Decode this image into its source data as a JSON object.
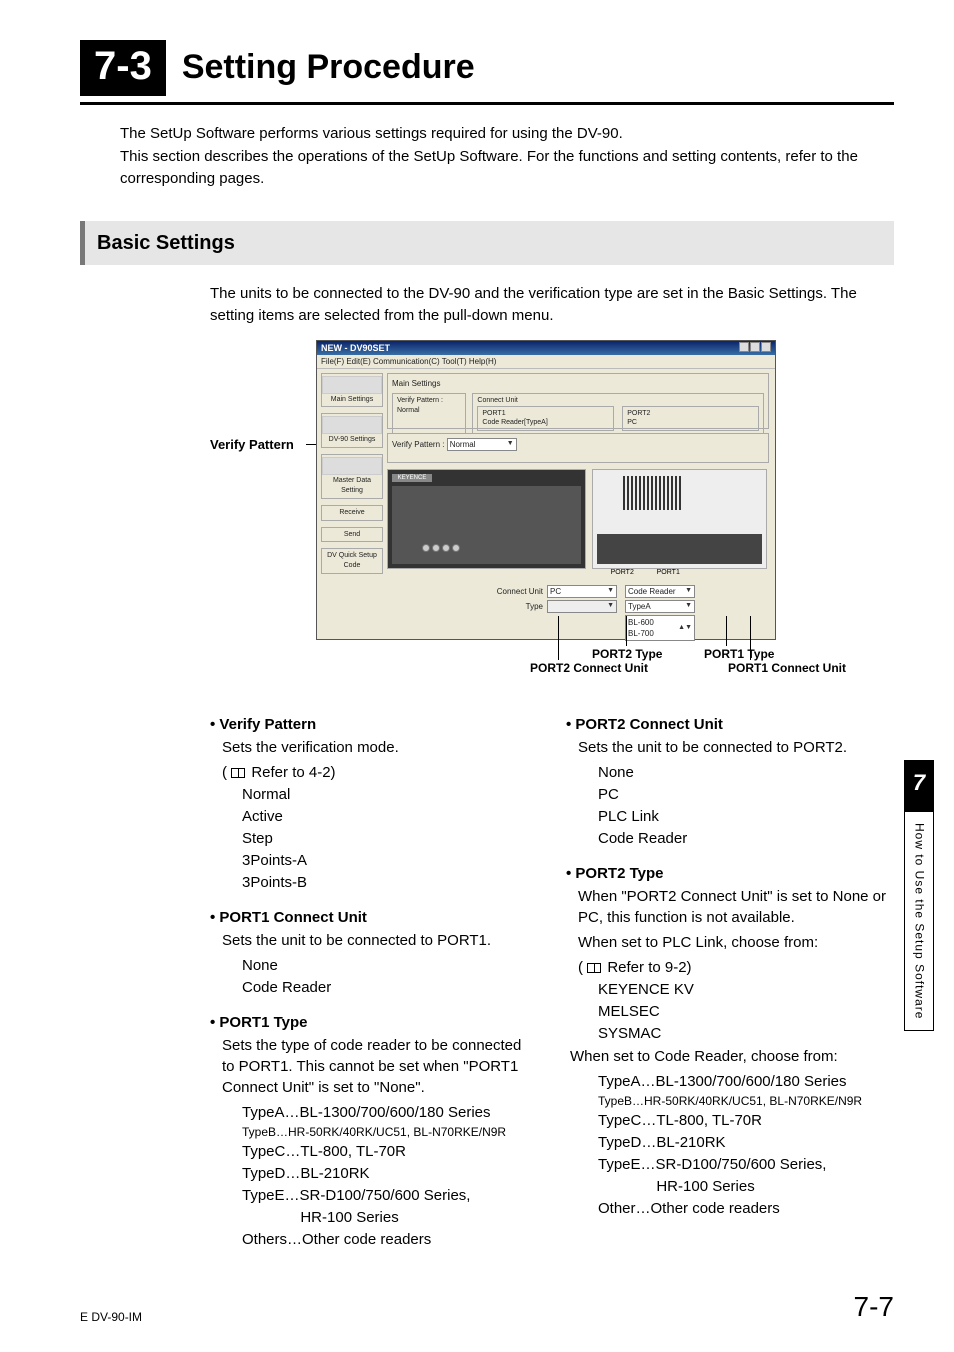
{
  "chapter": {
    "badge": "7-3",
    "title": "Setting Procedure"
  },
  "intro": {
    "p1": "The SetUp Software performs various settings required for using the DV-90.",
    "p2": "This section describes the operations of the SetUp Software. For the functions and setting contents, refer to the corresponding pages."
  },
  "section": {
    "title": "Basic Settings",
    "p1": "The units to be connected to the DV-90 and the verification type are set in the Basic Settings. The setting items are selected from the pull-down menu."
  },
  "screenshot": {
    "verify_pattern_label": "Verify Pattern",
    "dialog_title": "NEW - DV90SET",
    "menu": "File(F)  Edit(E)  Communication(C)  Tool(T)  Help(H)",
    "sidebar": [
      "Main Settings",
      "DV-90 Settings",
      "Master Data Setting",
      "Receive",
      "Send",
      "DV Quick Setup Code"
    ],
    "group_top": {
      "title": "Main Settings",
      "vp": "Verify Pattern :",
      "vp_val": "Normal",
      "cu": "Connect Unit",
      "p1": "PORT1",
      "p1_val": "Code Reader[TypeA]",
      "p2": "PORT2",
      "p2_val": "PC"
    },
    "group_v": {
      "title": "Verify Pattern :",
      "val": "Normal"
    },
    "diagram": {
      "brand": "KEYENCE",
      "port1": "PORT1",
      "port2": "PORT2"
    },
    "dd": {
      "connect": "Connect Unit",
      "type": "Type",
      "pc": "PC",
      "cr": "Code Reader",
      "ta": "TypeA",
      "models": "BL-600\nBL-700"
    },
    "callouts": {
      "p2type": "PORT2 Type",
      "p2cu": "PORT2 Connect Unit",
      "p1type": "PORT1 Type",
      "p1cu": "PORT1 Connect Unit"
    }
  },
  "left": {
    "verify": {
      "head": "Verify Pattern",
      "desc": "Sets the verification mode.",
      "ref": "Refer to 4-2)",
      "opts": [
        "Normal",
        "Active",
        "Step",
        "3Points-A",
        "3Points-B"
      ]
    },
    "p1cu": {
      "head": "PORT1 Connect Unit",
      "desc": "Sets the unit to be connected to PORT1.",
      "opts": [
        "None",
        "Code Reader"
      ]
    },
    "p1t": {
      "head": "PORT1 Type",
      "desc": "Sets the type of code reader to be connected to PORT1. This cannot be set when \"PORT1 Connect Unit\" is set to \"None\".",
      "opts": [
        "TypeA…BL-1300/700/600/180 Series",
        "TypeB…HR-50RK/40RK/UC51, BL-N70RKE/N9R",
        "TypeC…TL-800, TL-70R",
        "TypeD…BL-210RK",
        "TypeE…SR-D100/750/600 Series,",
        "              HR-100 Series",
        "Others…Other code readers"
      ]
    }
  },
  "right": {
    "p2cu": {
      "head": "PORT2 Connect Unit",
      "desc": "Sets the unit to be connected to PORT2.",
      "opts": [
        "None",
        "PC",
        "PLC Link",
        "Code Reader"
      ]
    },
    "p2t": {
      "head": "PORT2 Type",
      "desc1": "When \"PORT2 Connect Unit\" is set to None or PC, this function is not available.",
      "desc2": "When set to PLC Link, choose from:",
      "ref": "Refer to 9-2)",
      "plc": [
        "KEYENCE KV",
        "MELSEC",
        "SYSMAC"
      ],
      "desc3": "When set to Code Reader, choose from:",
      "cr": [
        "TypeA…BL-1300/700/600/180 Series",
        "TypeB…HR-50RK/40RK/UC51, BL-N70RKE/N9R",
        "TypeC…TL-800, TL-70R",
        "TypeD…BL-210RK",
        "TypeE…SR-D100/750/600 Series,",
        "              HR-100 Series",
        "Other…Other code readers"
      ]
    }
  },
  "sidetab": {
    "num": "7",
    "text": "How to Use the Setup Software"
  },
  "footer": {
    "left": "E DV-90-IM",
    "right": "7-7"
  }
}
